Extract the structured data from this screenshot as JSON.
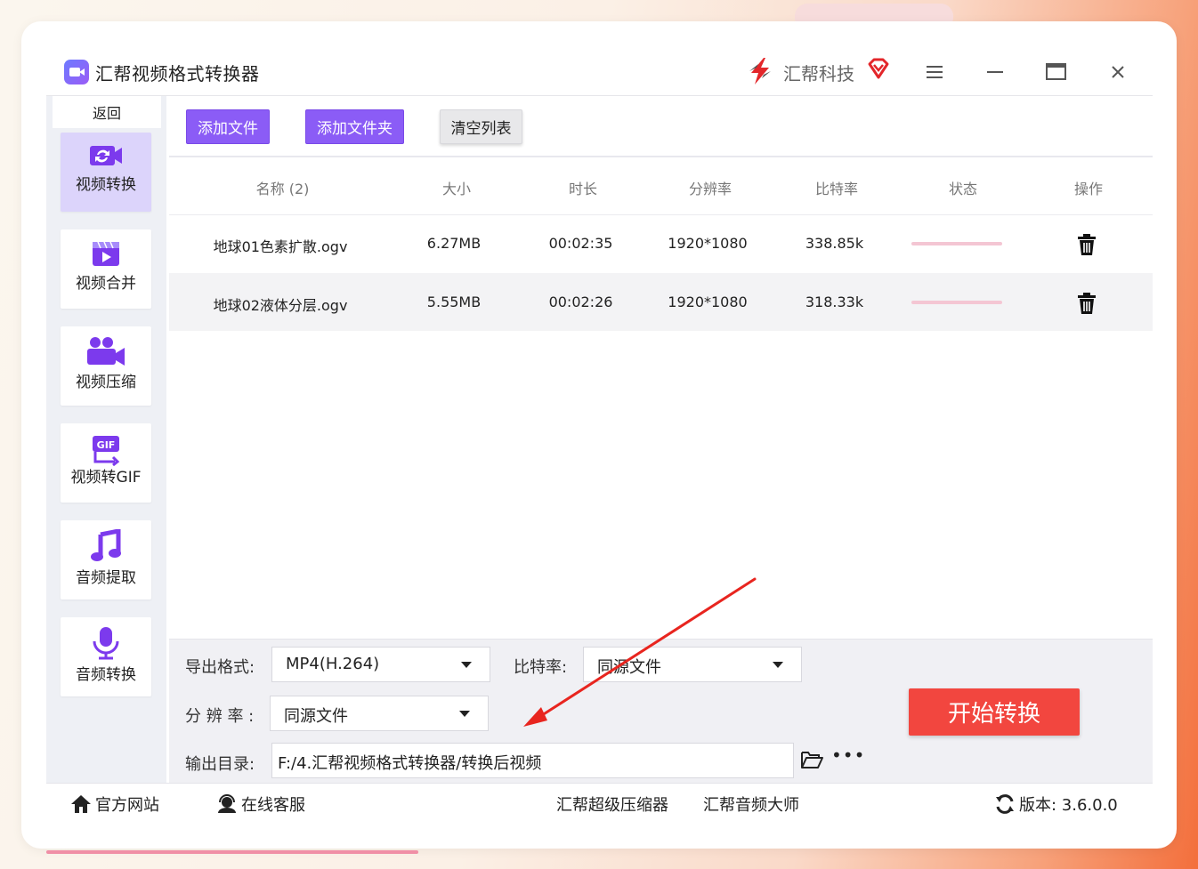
{
  "app": {
    "title": "汇帮视频格式转换器",
    "brand": "汇帮科技"
  },
  "sidebar": {
    "back_label": "返回",
    "items": [
      {
        "label": "视频转换",
        "icon": "video-convert-icon",
        "active": true
      },
      {
        "label": "视频合并",
        "icon": "video-merge-icon",
        "active": false
      },
      {
        "label": "视频压缩",
        "icon": "video-compress-icon",
        "active": false
      },
      {
        "label": "视频转GIF",
        "icon": "gif-icon",
        "active": false
      },
      {
        "label": "音频提取",
        "icon": "music-note-icon",
        "active": false
      },
      {
        "label": "音频转换",
        "icon": "microphone-icon",
        "active": false
      }
    ]
  },
  "toolbar": {
    "add_file": "添加文件",
    "add_folder": "添加文件夹",
    "clear_list": "清空列表"
  },
  "table": {
    "columns": [
      "名称 (2)",
      "大小",
      "时长",
      "分辨率",
      "比特率",
      "状态",
      "操作"
    ],
    "rows": [
      {
        "name": "地球01色素扩散.ogv",
        "size": "6.27MB",
        "duration": "00:02:35",
        "resolution": "1920*1080",
        "bitrate": "338.85k"
      },
      {
        "name": "地球02液体分层.ogv",
        "size": "5.55MB",
        "duration": "00:02:26",
        "resolution": "1920*1080",
        "bitrate": "318.33k"
      }
    ]
  },
  "settings": {
    "format_label": "导出格式:",
    "format_value": "MP4(H.264)",
    "bitrate_label": "比特率:",
    "bitrate_value": "同源文件",
    "resolution_label": "分 辨 率 :",
    "resolution_value": "同源文件",
    "output_label": "输出目录:",
    "output_value": "F:/4.汇帮视频格式转换器/转换后视频",
    "start_button": "开始转换"
  },
  "footer": {
    "website": "官方网站",
    "support": "在线客服",
    "compressor": "汇帮超级压缩器",
    "audio_master": "汇帮音频大师",
    "version": "版本: 3.6.0.0"
  },
  "colors": {
    "accent_purple": "#8b5cf6",
    "start_red": "#f2463f",
    "active_nav": "#dcd4fb",
    "progress_pink": "#f4c6d3",
    "annotation_arrow": "#e8251f"
  }
}
